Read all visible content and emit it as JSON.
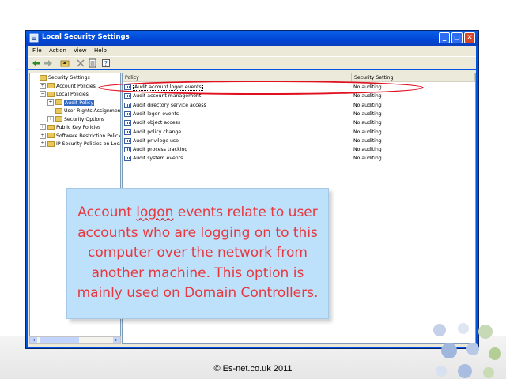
{
  "window": {
    "title": "Local Security Settings",
    "controls": {
      "minimize": "_",
      "maximize": "□",
      "close": "✕"
    }
  },
  "menu": [
    "File",
    "Action",
    "View",
    "Help"
  ],
  "toolbar": {
    "icons": [
      "back-arrow-icon",
      "forward-arrow-icon",
      "up-folder-icon",
      "delete-icon",
      "properties-icon",
      "help-icon"
    ]
  },
  "tree": {
    "items": [
      {
        "label": "Security Settings",
        "level": 0,
        "expander": "",
        "selected": false
      },
      {
        "label": "Account Policies",
        "level": 1,
        "expander": "+",
        "selected": false
      },
      {
        "label": "Local Policies",
        "level": 1,
        "expander": "−",
        "selected": false
      },
      {
        "label": "Audit Policy",
        "level": 2,
        "expander": "+",
        "selected": true
      },
      {
        "label": "User Rights Assignmen",
        "level": 2,
        "expander": "",
        "selected": false
      },
      {
        "label": "Security Options",
        "level": 2,
        "expander": "+",
        "selected": false
      },
      {
        "label": "Public Key Policies",
        "level": 1,
        "expander": "+",
        "selected": false
      },
      {
        "label": "Software Restriction Policie",
        "level": 1,
        "expander": "+",
        "selected": false
      },
      {
        "label": "IP Security Policies on Loca",
        "level": 1,
        "expander": "+",
        "selected": false
      }
    ]
  },
  "list": {
    "columns": [
      "Policy",
      "Security Setting"
    ],
    "rows": [
      {
        "policy": "Audit account logon events",
        "setting": "No auditing",
        "selected": true
      },
      {
        "policy": "Audit account management",
        "setting": "No auditing",
        "selected": false
      },
      {
        "policy": "Audit directory service access",
        "setting": "No auditing",
        "selected": false
      },
      {
        "policy": "Audit logon events",
        "setting": "No auditing",
        "selected": false
      },
      {
        "policy": "Audit object access",
        "setting": "No auditing",
        "selected": false
      },
      {
        "policy": "Audit policy change",
        "setting": "No auditing",
        "selected": false
      },
      {
        "policy": "Audit privilege use",
        "setting": "No auditing",
        "selected": false
      },
      {
        "policy": "Audit process tracking",
        "setting": "No auditing",
        "selected": false
      },
      {
        "policy": "Audit system events",
        "setting": "No auditing",
        "selected": false
      }
    ]
  },
  "callout": {
    "prefix": "Account ",
    "underlined": "logon",
    "suffix": " events relate to user accounts who are logging on to this computer over the network from another machine. This option is mainly used on Domain Controllers."
  },
  "footer": {
    "copyright": "© Es-net.co.uk 2011"
  },
  "colors": {
    "xp_blue": "#0054e3",
    "highlight_red": "#e01020",
    "callout_bg": "#bde0fb",
    "callout_text": "#e8383d"
  }
}
